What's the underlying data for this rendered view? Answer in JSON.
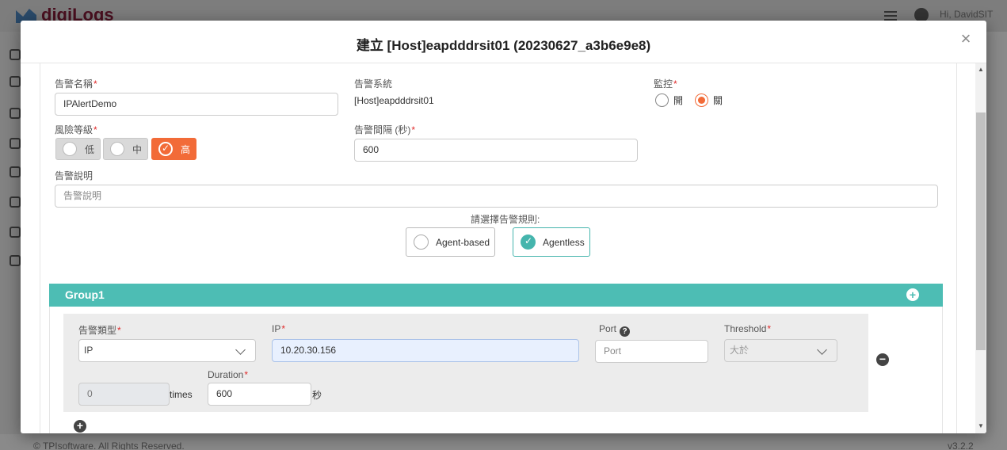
{
  "background": {
    "logo_text": "digiLogs",
    "user_greeting": "Hi, DavidSIT",
    "copyright": "© TPIsoftware. All Rights Reserved.",
    "version": "v3.2.2"
  },
  "modal": {
    "title": "建立 [Host]eapdddrsit01 (20230627_a3b6e9e8)",
    "close_glyph": "×"
  },
  "form": {
    "alert_name": {
      "label": "告警名稱",
      "value": "IPAlertDemo"
    },
    "alert_system": {
      "label": "告警系統",
      "value": "[Host]eapdddrsit01"
    },
    "monitor": {
      "label": "監控",
      "options": [
        "開",
        "關"
      ],
      "selected": "關"
    },
    "risk_level": {
      "label": "風險等級",
      "options": [
        "低",
        "中",
        "高"
      ],
      "selected": "高"
    },
    "alert_interval": {
      "label": "告警間隔 (秒)",
      "value": "600"
    },
    "alert_description": {
      "label": "告警說明",
      "placeholder": "告警說明"
    },
    "rule_prompt": "請選擇告警規則:",
    "rule_options": [
      "Agent-based",
      "Agentless"
    ],
    "rule_selected": "Agentless"
  },
  "group": {
    "title": "Group1",
    "condition": {
      "alert_type_label": "告警類型",
      "alert_type_value": "IP",
      "ip_label": "IP",
      "ip_value": "10.20.30.156",
      "port_label": "Port",
      "port_placeholder": "Port",
      "threshold_label": "Threshold",
      "threshold_value": "大於",
      "duration_label": "Duration",
      "times_value": "0",
      "times_unit": "times",
      "duration_value": "600",
      "duration_unit": "秒"
    }
  },
  "icons": {
    "plus": "+",
    "minus": "−",
    "help": "?"
  }
}
